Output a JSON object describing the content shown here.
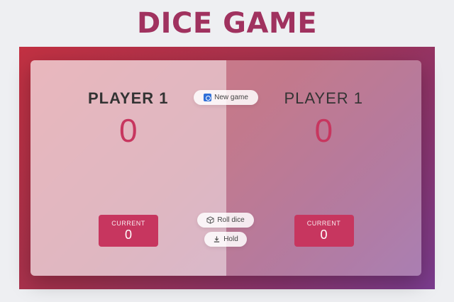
{
  "page": {
    "title": "DICE GAME"
  },
  "players": [
    {
      "name": "PLAYER 1",
      "score": "0",
      "current_label": "CURRENT",
      "current_score": "0"
    },
    {
      "name": "PLAYER 1",
      "score": "0",
      "current_label": "CURRENT",
      "current_score": "0"
    }
  ],
  "buttons": {
    "new_game": {
      "label": "New game",
      "icon": "new-game-icon"
    },
    "roll_dice": {
      "label": "Roll dice",
      "icon": "dice-icon"
    },
    "hold": {
      "label": "Hold",
      "icon": "download-icon"
    }
  },
  "colors": {
    "title": "#a0325f",
    "score": "#c7365f",
    "current_box": "#c7365f",
    "icon_new": "#2f6fd8"
  }
}
